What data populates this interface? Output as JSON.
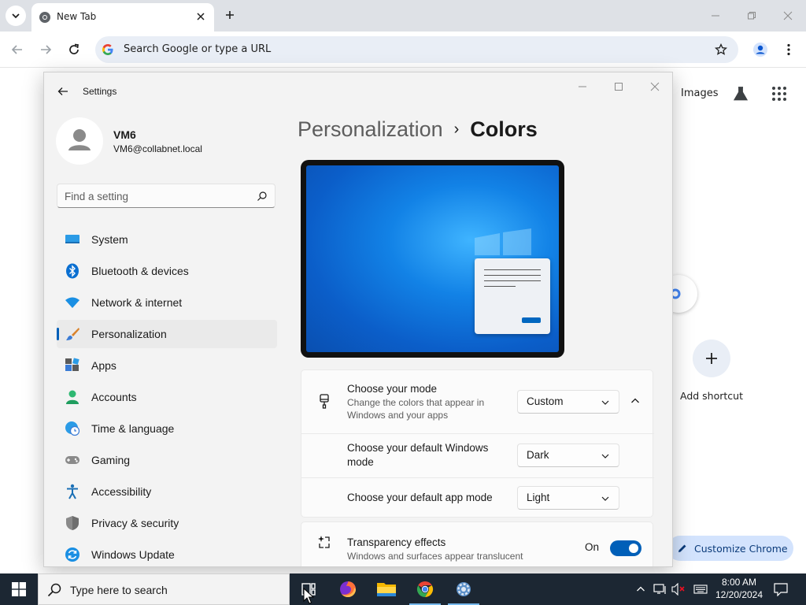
{
  "browser": {
    "tab_title": "New Tab",
    "omnibox_placeholder": "Search Google or type a URL",
    "ntp": {
      "images_link": "Images",
      "shortcut_label": "Add shortcut",
      "customize_label": "Customize Chrome"
    }
  },
  "settings": {
    "window_title": "Settings",
    "user": {
      "name": "VM6",
      "email": "VM6@collabnet.local"
    },
    "search_placeholder": "Find a setting",
    "nav": [
      {
        "label": "System",
        "icon": "system-icon"
      },
      {
        "label": "Bluetooth & devices",
        "icon": "bluetooth-icon"
      },
      {
        "label": "Network & internet",
        "icon": "wifi-icon"
      },
      {
        "label": "Personalization",
        "icon": "paintbrush-icon",
        "active": true
      },
      {
        "label": "Apps",
        "icon": "apps-icon"
      },
      {
        "label": "Accounts",
        "icon": "accounts-icon"
      },
      {
        "label": "Time & language",
        "icon": "globe-clock-icon"
      },
      {
        "label": "Gaming",
        "icon": "gamepad-icon"
      },
      {
        "label": "Accessibility",
        "icon": "accessibility-icon"
      },
      {
        "label": "Privacy & security",
        "icon": "shield-icon"
      },
      {
        "label": "Windows Update",
        "icon": "update-icon"
      }
    ],
    "breadcrumb": {
      "parent": "Personalization",
      "separator": "›",
      "current": "Colors"
    },
    "mode": {
      "title": "Choose your mode",
      "subtitle": "Change the colors that appear in Windows and your apps",
      "value": "Custom"
    },
    "windows_mode": {
      "title": "Choose your default Windows mode",
      "value": "Dark"
    },
    "app_mode": {
      "title": "Choose your default app mode",
      "value": "Light"
    },
    "transparency": {
      "title": "Transparency effects",
      "subtitle": "Windows and surfaces appear translucent",
      "state_label": "On",
      "enabled": true
    },
    "accent_color": "#005fb8"
  },
  "taskbar": {
    "search_placeholder": "Type here to search",
    "time": "8:00 AM",
    "date": "12/20/2024"
  }
}
